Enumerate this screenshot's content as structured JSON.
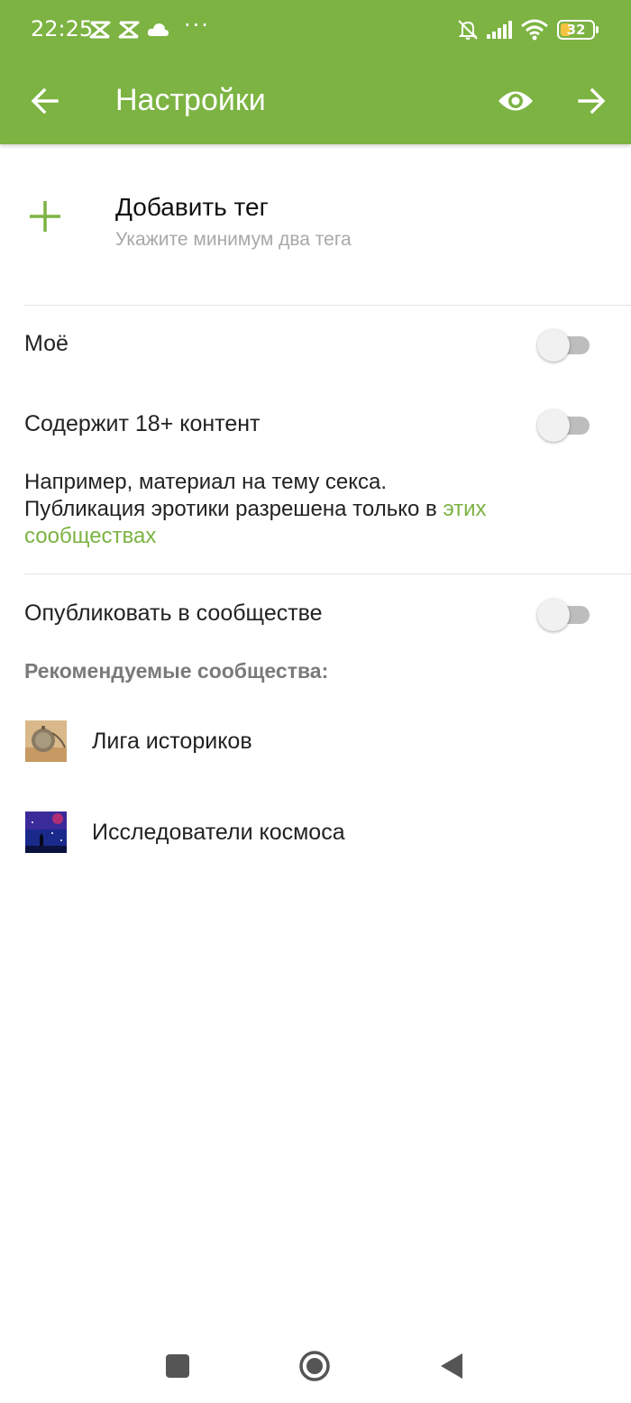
{
  "status_bar": {
    "time": "22:25",
    "more_indicator": "···",
    "battery_level": "32",
    "battery_fraction": 0.32,
    "icons": [
      "capcut-icon",
      "capcut-icon",
      "cloud-icon",
      "bell-muted-icon",
      "signal-icon",
      "wifi-icon",
      "battery-icon"
    ]
  },
  "toolbar": {
    "title": "Настройки",
    "back_icon": "arrow-left-icon",
    "preview_icon": "eye-icon",
    "next_icon": "arrow-right-icon"
  },
  "add_tag": {
    "label": "Добавить тег",
    "hint": "Укажите минимум два тега",
    "icon": "plus-icon"
  },
  "settings": {
    "mine": {
      "label": "Моё",
      "enabled": false
    },
    "adult": {
      "label": "Содержит 18+ контент",
      "enabled": false
    },
    "adult_note": {
      "line1": "Например, материал на тему секса.",
      "line2": "Публикация эротики разрешена только в ",
      "link": "этих сообществах"
    },
    "publish": {
      "label": "Опубликовать в сообществе",
      "enabled": false
    }
  },
  "recommended": {
    "title": "Рекомендуемые сообщества:",
    "items": [
      {
        "name": "Лига историков"
      },
      {
        "name": "Исследователи космоса"
      }
    ]
  },
  "colors": {
    "accent": "#7cb342",
    "divider": "#e4e4e4",
    "section_title": "#7a7a7a"
  },
  "nav_bar": {
    "icons": [
      "recent-apps-icon",
      "home-icon",
      "back-icon"
    ]
  }
}
